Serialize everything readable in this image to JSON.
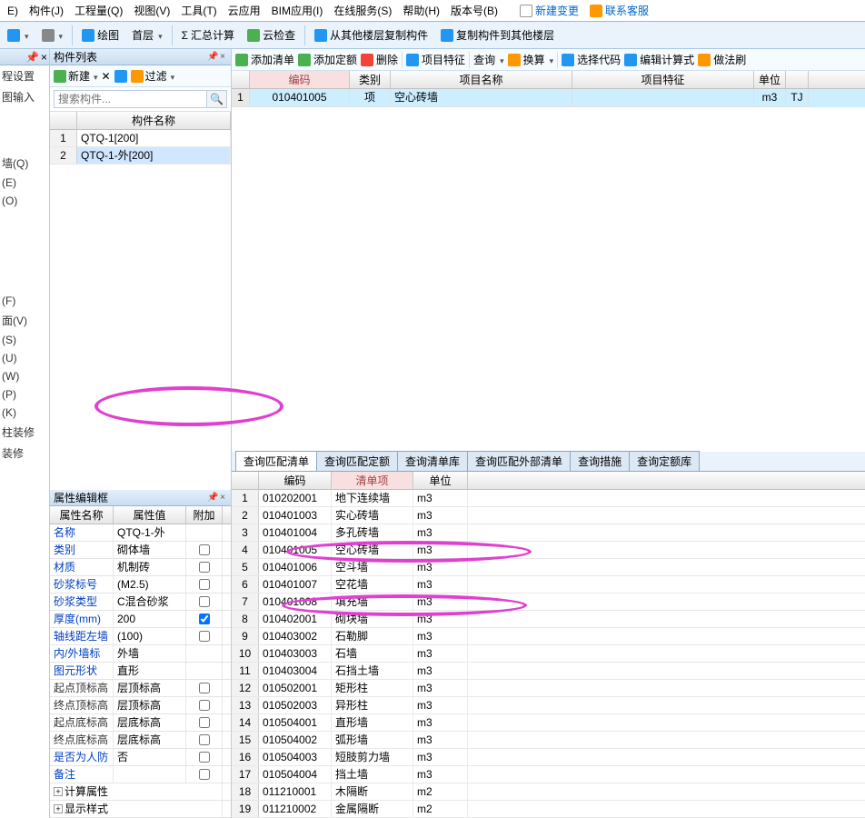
{
  "menu": {
    "items": [
      "E)",
      "构件(J)",
      "工程量(Q)",
      "视图(V)",
      "工具(T)",
      "云应用",
      "BIM应用(I)",
      "在线服务(S)",
      "帮助(H)",
      "版本号(B)"
    ],
    "right": [
      {
        "label": "新建变更"
      },
      {
        "label": "联系客服"
      }
    ]
  },
  "toolbar": {
    "draw": "绘图",
    "floor": "首层",
    "calc": "汇总计算",
    "cloud": "云检查",
    "copyfrom": "从其他楼层复制构件",
    "copyto": "复制构件到其他楼层"
  },
  "left": {
    "heading1": "程设置",
    "heading2": "图输入",
    "items1": [
      "墙(Q)",
      "(E)",
      "(O)"
    ],
    "items2": [
      "(F)",
      "面(V)",
      "(S)",
      "(U)",
      "(W)",
      "(P)",
      "(K)",
      "柱装修",
      "装修"
    ]
  },
  "componentList": {
    "title": "构件列表",
    "new": "新建",
    "filter": "过滤",
    "searchPlaceholder": "搜索构件...",
    "header": "构件名称",
    "rows": [
      {
        "n": "1",
        "name": "QTQ-1[200]"
      },
      {
        "n": "2",
        "name": "QTQ-1-外[200]"
      }
    ]
  },
  "props": {
    "title": "属性编辑框",
    "headers": [
      "属性名称",
      "属性值",
      "附加"
    ],
    "rows": [
      {
        "name": "名称",
        "val": "QTQ-1-外",
        "blue": true,
        "chk": false,
        "nocheck": true
      },
      {
        "name": "类别",
        "val": "砌体墙",
        "blue": true,
        "chk": false
      },
      {
        "name": "材质",
        "val": "机制砖",
        "blue": true,
        "chk": false
      },
      {
        "name": "砂浆标号",
        "val": "(M2.5)",
        "blue": true,
        "chk": false
      },
      {
        "name": "砂浆类型",
        "val": "C混合砂浆",
        "blue": true,
        "chk": false
      },
      {
        "name": "厚度(mm)",
        "val": "200",
        "blue": true,
        "chk": true
      },
      {
        "name": "轴线距左墙",
        "val": "(100)",
        "blue": true,
        "chk": false
      },
      {
        "name": "内/外墙标",
        "val": "外墙",
        "blue": true,
        "chk": false,
        "nocheck": true
      },
      {
        "name": "图元形状",
        "val": "直形",
        "blue": true,
        "chk": false,
        "nocheck": true
      },
      {
        "name": "起点顶标高",
        "val": "层顶标高",
        "blue": false,
        "chk": false
      },
      {
        "name": "终点顶标高",
        "val": "层顶标高",
        "blue": false,
        "chk": false
      },
      {
        "name": "起点底标高",
        "val": "层底标高",
        "blue": false,
        "chk": false
      },
      {
        "name": "终点底标高",
        "val": "层底标高",
        "blue": false,
        "chk": false
      },
      {
        "name": "是否为人防",
        "val": "否",
        "blue": true,
        "chk": false
      },
      {
        "name": "备注",
        "val": "",
        "blue": true,
        "chk": false
      }
    ],
    "groups": [
      "计算属性",
      "显示样式"
    ]
  },
  "rightToolbar": {
    "items": [
      "添加清单",
      "添加定额",
      "删除",
      "项目特征",
      "查询",
      "换算",
      "选择代码",
      "编辑计算式",
      "做法刷"
    ]
  },
  "topGrid": {
    "headers": [
      "",
      "编码",
      "类别",
      "项目名称",
      "项目特征",
      "单位",
      ""
    ],
    "row": {
      "n": "1",
      "code": "010401005",
      "type": "项",
      "name": "空心砖墙",
      "feat": "",
      "unit": "m3",
      "last": "TJ"
    }
  },
  "tabs": [
    "查询匹配清单",
    "查询匹配定额",
    "查询清单库",
    "查询匹配外部清单",
    "查询措施",
    "查询定额库"
  ],
  "bottomGrid": {
    "headers": [
      "",
      "编码",
      "清单项",
      "单位"
    ],
    "rows": [
      {
        "n": "1",
        "code": "010202001",
        "name": "地下连续墙",
        "unit": "m3"
      },
      {
        "n": "2",
        "code": "010401003",
        "name": "实心砖墙",
        "unit": "m3"
      },
      {
        "n": "3",
        "code": "010401004",
        "name": "多孔砖墙",
        "unit": "m3"
      },
      {
        "n": "4",
        "code": "010401005",
        "name": "空心砖墙",
        "unit": "m3"
      },
      {
        "n": "5",
        "code": "010401006",
        "name": "空斗墙",
        "unit": "m3"
      },
      {
        "n": "6",
        "code": "010401007",
        "name": "空花墙",
        "unit": "m3"
      },
      {
        "n": "7",
        "code": "010401008",
        "name": "填充墙",
        "unit": "m3"
      },
      {
        "n": "8",
        "code": "010402001",
        "name": "砌块墙",
        "unit": "m3"
      },
      {
        "n": "9",
        "code": "010403002",
        "name": "石勒脚",
        "unit": "m3"
      },
      {
        "n": "10",
        "code": "010403003",
        "name": "石墙",
        "unit": "m3"
      },
      {
        "n": "11",
        "code": "010403004",
        "name": "石挡土墙",
        "unit": "m3"
      },
      {
        "n": "12",
        "code": "010502001",
        "name": "矩形柱",
        "unit": "m3"
      },
      {
        "n": "13",
        "code": "010502003",
        "name": "异形柱",
        "unit": "m3"
      },
      {
        "n": "14",
        "code": "010504001",
        "name": "直形墙",
        "unit": "m3"
      },
      {
        "n": "15",
        "code": "010504002",
        "name": "弧形墙",
        "unit": "m3"
      },
      {
        "n": "16",
        "code": "010504003",
        "name": "短肢剪力墙",
        "unit": "m3"
      },
      {
        "n": "17",
        "code": "010504004",
        "name": "挡土墙",
        "unit": "m3"
      },
      {
        "n": "18",
        "code": "011210001",
        "name": "木隔断",
        "unit": "m2"
      },
      {
        "n": "19",
        "code": "011210002",
        "name": "金属隔断",
        "unit": "m2"
      }
    ]
  }
}
